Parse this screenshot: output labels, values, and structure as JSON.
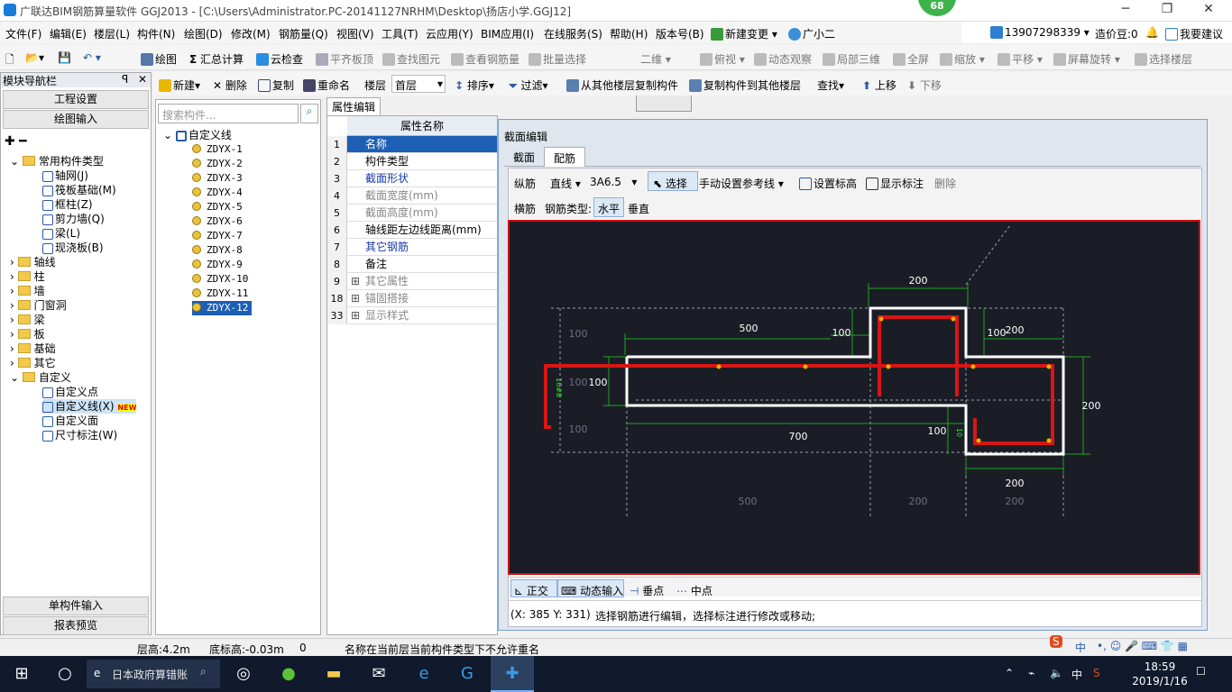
{
  "window": {
    "title": "广联达BIM钢筋算量软件 GGJ2013 - [C:\\Users\\Administrator.PC-20141127NRHM\\Desktop\\扬店小学.GGJ12]",
    "badge": "68"
  },
  "menu": [
    "文件(F)",
    "编辑(E)",
    "楼层(L)",
    "构件(N)",
    "绘图(D)",
    "修改(M)",
    "钢筋量(Q)",
    "视图(V)",
    "工具(T)",
    "云应用(Y)",
    "BIM应用(I)",
    "在线服务(S)",
    "帮助(H)",
    "版本号(B)",
    "新建变更",
    "广小二"
  ],
  "account": {
    "phone": "13907298339",
    "bean": "造价豆:0",
    "feedback": "我要建议"
  },
  "toolbar1": [
    "绘图",
    "汇总计算",
    "云检查",
    "平齐板顶",
    "查找图元",
    "查看钢筋量",
    "批量选择",
    "二维",
    "俯视",
    "动态观察",
    "局部三维",
    "全屏",
    "缩放",
    "平移",
    "屏幕旋转",
    "选择楼层"
  ],
  "toolbar2": {
    "items": [
      "新建",
      "删除",
      "复制",
      "重命名"
    ],
    "floor_label": "楼层",
    "floor_value": "首层",
    "items2": [
      "排序",
      "过滤",
      "从其他楼层复制构件",
      "复制构件到其他楼层",
      "查找",
      "上移",
      "下移"
    ]
  },
  "nav": {
    "title": "模块导航栏",
    "btn1": "工程设置",
    "btn2": "绘图输入",
    "btn3": "单构件输入",
    "btn4": "报表预览",
    "tree": [
      {
        "label": "常用构件类型",
        "type": "folder"
      },
      {
        "label": "轴网(J)",
        "type": "sub"
      },
      {
        "label": "筏板基础(M)",
        "type": "sub"
      },
      {
        "label": "框柱(Z)",
        "type": "sub"
      },
      {
        "label": "剪力墙(Q)",
        "type": "sub"
      },
      {
        "label": "梁(L)",
        "type": "sub"
      },
      {
        "label": "现浇板(B)",
        "type": "sub"
      },
      {
        "label": "轴线",
        "type": "folder"
      },
      {
        "label": "柱",
        "type": "folder"
      },
      {
        "label": "墙",
        "type": "folder"
      },
      {
        "label": "门窗洞",
        "type": "folder"
      },
      {
        "label": "梁",
        "type": "folder"
      },
      {
        "label": "板",
        "type": "folder"
      },
      {
        "label": "基础",
        "type": "folder"
      },
      {
        "label": "其它",
        "type": "folder"
      },
      {
        "label": "自定义",
        "type": "folder"
      },
      {
        "label": "自定义点",
        "type": "sub"
      },
      {
        "label": "自定义线(X)",
        "type": "sub",
        "badge": "NEW"
      },
      {
        "label": "自定义面",
        "type": "sub"
      },
      {
        "label": "尺寸标注(W)",
        "type": "sub"
      }
    ]
  },
  "list": {
    "search_placeholder": "搜索构件...",
    "root": "自定义线",
    "items": [
      "ZDYX-1",
      "ZDYX-2",
      "ZDYX-3",
      "ZDYX-4",
      "ZDYX-5",
      "ZDYX-6",
      "ZDYX-7",
      "ZDYX-8",
      "ZDYX-9",
      "ZDYX-10",
      "ZDYX-11",
      "ZDYX-12"
    ],
    "selected": "ZDYX-12"
  },
  "props": {
    "tab": "属性编辑",
    "header": "属性名称",
    "rows": [
      {
        "n": "1",
        "name": "名称"
      },
      {
        "n": "2",
        "name": "构件类型"
      },
      {
        "n": "3",
        "name": "截面形状"
      },
      {
        "n": "4",
        "name": "截面宽度(mm)"
      },
      {
        "n": "5",
        "name": "截面高度(mm)"
      },
      {
        "n": "6",
        "name": "轴线距左边线距离(mm)"
      },
      {
        "n": "7",
        "name": "其它钢筋"
      },
      {
        "n": "8",
        "name": "备注"
      },
      {
        "n": "9",
        "name": "其它属性"
      },
      {
        "n": "18",
        "name": "锚固搭接"
      },
      {
        "n": "33",
        "name": "显示样式"
      }
    ]
  },
  "dialog": {
    "title": "截面编辑",
    "tabs": [
      "截面",
      "配筋"
    ],
    "row1": {
      "label": "纵筋",
      "shape": "直线",
      "spec": "3A6.5",
      "select": "选择",
      "manual": "手动设置参考线",
      "elev": "设置标高",
      "show": "显示标注",
      "delete": "删除"
    },
    "row2": {
      "label": "横筋",
      "type_label": "钢筋类型:",
      "h": "水平",
      "v": "垂直"
    },
    "bottom": {
      "ortho": "正交",
      "dyn": "动态输入",
      "perp": "垂点",
      "mid": "中点"
    },
    "coord": "(X: 385 Y: 331)",
    "hint": "选择钢筋进行编辑，选择标注进行修改或移动;"
  },
  "drawing": {
    "dims": [
      "200",
      "500",
      "100",
      "100",
      "200",
      "100",
      "700",
      "100",
      "200",
      "200",
      "500",
      "200",
      "200",
      "100",
      "100",
      "100"
    ],
    "vtext": [
      "16#8",
      "10"
    ]
  },
  "status": {
    "floor_h": "层高:4.2m",
    "base": "底标高:-0.03m",
    "zero": "0",
    "msg": "名称在当前层当前构件类型下不允许重名"
  },
  "taskbar": {
    "search": "日本政府算错账",
    "time": "18:59",
    "date": "2019/1/16",
    "ime": "中",
    "lang": "中"
  }
}
